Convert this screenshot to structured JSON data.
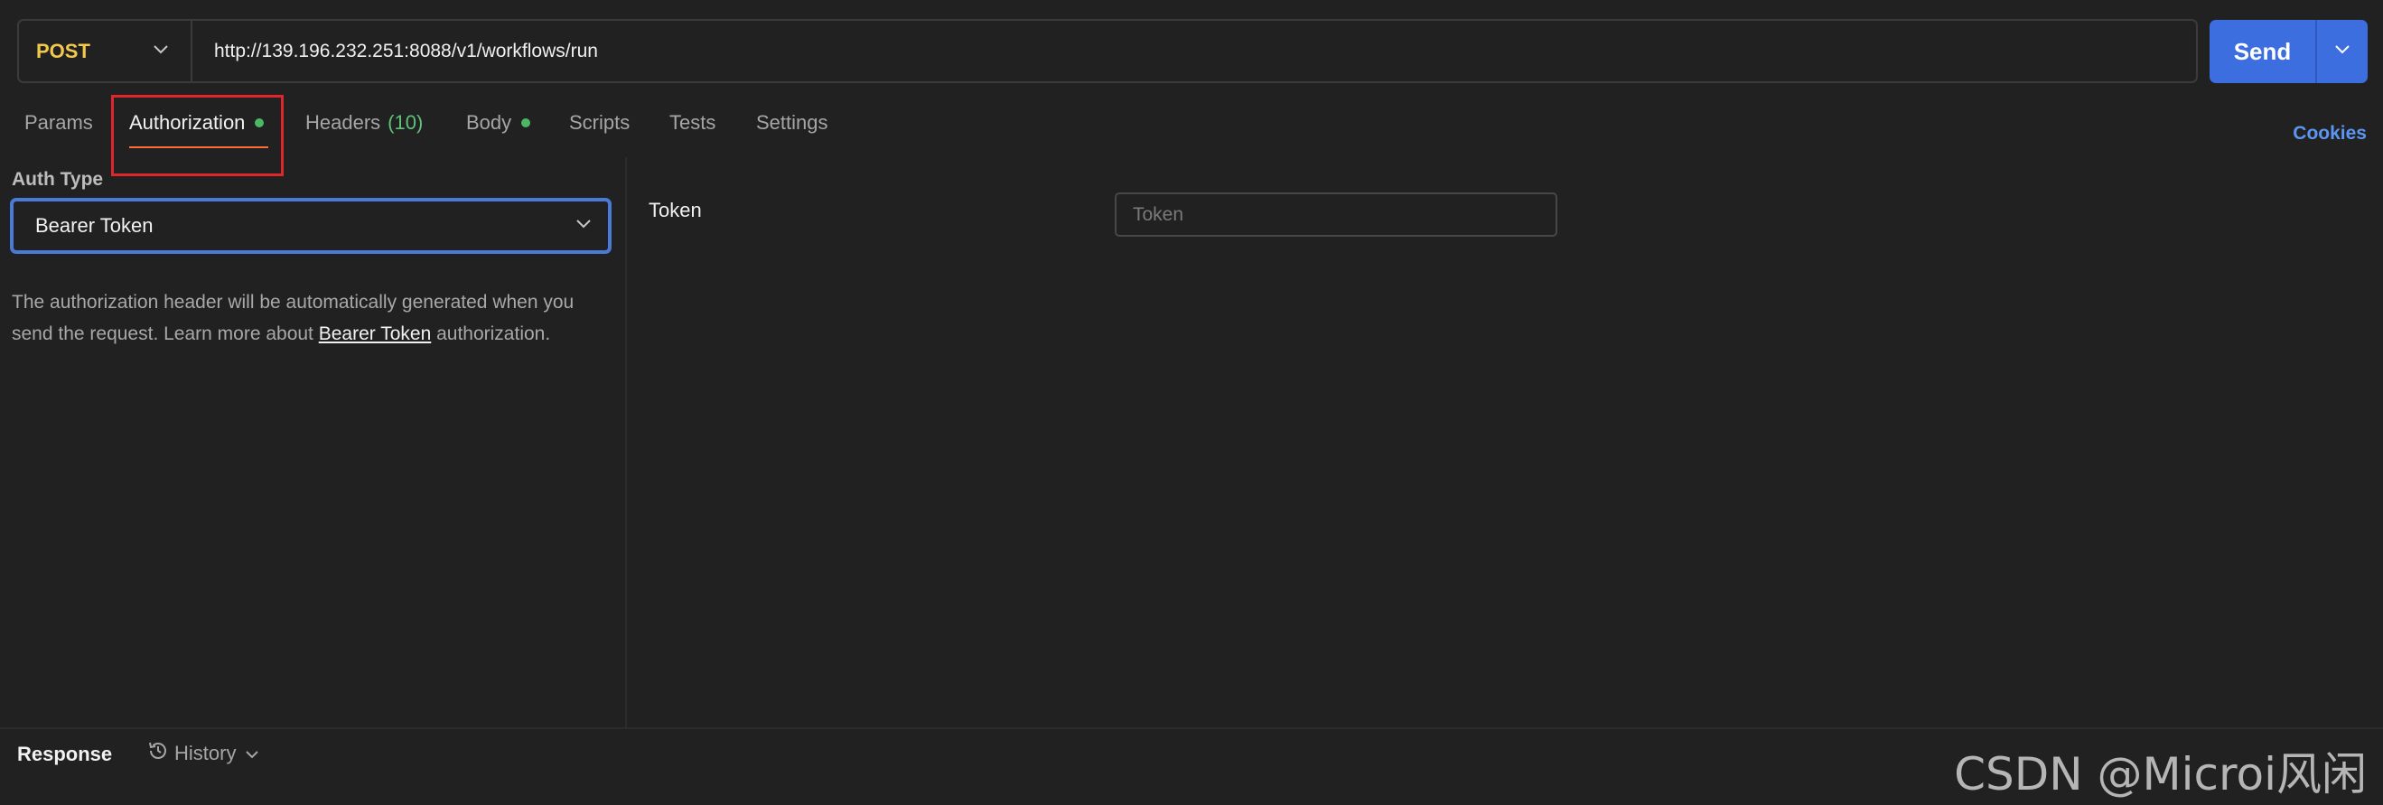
{
  "request": {
    "method": "POST",
    "url": "http://139.196.232.251:8088/v1/workflows/run",
    "send_label": "Send"
  },
  "tabs": [
    {
      "label": "Params"
    },
    {
      "label": "Authorization"
    },
    {
      "label": "Headers",
      "count": "(10)"
    },
    {
      "label": "Body"
    },
    {
      "label": "Scripts"
    },
    {
      "label": "Tests"
    },
    {
      "label": "Settings"
    }
  ],
  "active_tab": "Authorization",
  "cookies_label": "Cookies",
  "auth": {
    "type_label": "Auth Type",
    "type_value": "Bearer Token",
    "description_pre": "The authorization header will be automatically generated when you send the request. Learn more about ",
    "description_link": "Bearer Token",
    "description_post": " authorization."
  },
  "token": {
    "label": "Token",
    "placeholder": "Token",
    "value": ""
  },
  "bottom": {
    "response_label": "Response",
    "history_label": "History"
  },
  "watermark": "CSDN @Microi风闲",
  "colors": {
    "accent": "#3d6ee0",
    "method": "#f2c94c",
    "status_dot": "#4cb865",
    "highlight": "#e0262b",
    "link": "#5c96f2"
  }
}
